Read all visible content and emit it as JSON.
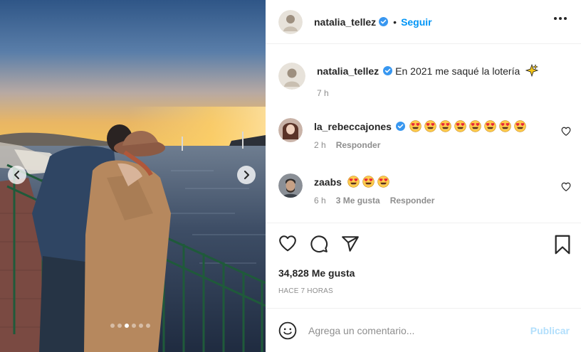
{
  "header": {
    "username": "natalia_tellez",
    "separator": "•",
    "follow_label": "Seguir"
  },
  "caption": {
    "username": "natalia_tellez",
    "text": "En 2021 me saqué la lotería",
    "emoji": "sparkles-icon",
    "time": "7 h"
  },
  "comments": [
    {
      "username": "la_rebeccajones",
      "verified": true,
      "emoji": "heart-eyes-emoji",
      "emoji_count": 8,
      "time": "2 h",
      "likes": "",
      "reply_label": "Responder"
    },
    {
      "username": "zaabs",
      "verified": false,
      "emoji": "heart-eyes-emoji",
      "emoji_count": 3,
      "time": "6 h",
      "likes": "3 Me gusta",
      "reply_label": "Responder"
    }
  ],
  "actions": {
    "likes_text": "34,828 Me gusta",
    "posted_time": "HACE 7 HORAS"
  },
  "add_comment": {
    "placeholder": "Agrega un comentario...",
    "publish_label": "Publicar"
  },
  "carousel": {
    "total": 6,
    "active_index": 2
  },
  "colors": {
    "link_blue": "#0095f6",
    "publish_disabled": "#b2dffc",
    "verified_badge": "#3897f0",
    "muted_text": "#8e8e8e"
  }
}
